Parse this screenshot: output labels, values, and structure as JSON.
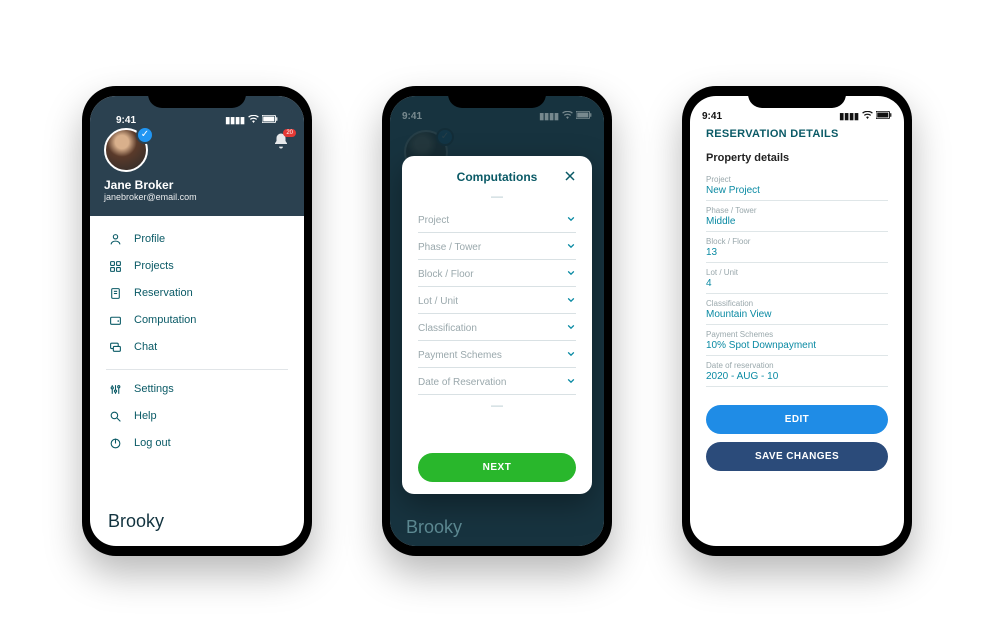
{
  "status_time": "9:41",
  "phone1": {
    "user_name": "Jane Broker",
    "user_email": "janebroker@email.com",
    "notification_count": "20",
    "menu_primary": [
      {
        "icon": "person",
        "label": "Profile"
      },
      {
        "icon": "grid",
        "label": "Projects"
      },
      {
        "icon": "doc",
        "label": "Reservation"
      },
      {
        "icon": "wallet",
        "label": "Computation"
      },
      {
        "icon": "chat",
        "label": "Chat"
      }
    ],
    "menu_secondary": [
      {
        "icon": "sliders",
        "label": "Settings"
      },
      {
        "icon": "search",
        "label": "Help"
      },
      {
        "icon": "logout",
        "label": "Log out"
      }
    ],
    "brand": "Brooky"
  },
  "phone2": {
    "modal_title": "Computations",
    "fields": [
      "Project",
      "Phase / Tower",
      "Block / Floor",
      "Lot / Unit",
      "Classification",
      "Payment Schemes",
      "Date of Reservation"
    ],
    "next_label": "NEXT",
    "brand": "Brooky"
  },
  "phone3": {
    "page_title": "RESERVATION DETAILS",
    "section_title": "Property details",
    "fields": [
      {
        "label": "Project",
        "value": "New Project"
      },
      {
        "label": "Phase / Tower",
        "value": "Middle"
      },
      {
        "label": "Block / Floor",
        "value": "13"
      },
      {
        "label": "Lot / Unit",
        "value": "4"
      },
      {
        "label": "Classification",
        "value": "Mountain View"
      },
      {
        "label": "Payment Schemes",
        "value": "10% Spot Downpayment"
      },
      {
        "label": "Date of reservation",
        "value": "2020 - AUG - 10"
      }
    ],
    "edit_label": "EDIT",
    "save_label": "SAVE CHANGES"
  }
}
